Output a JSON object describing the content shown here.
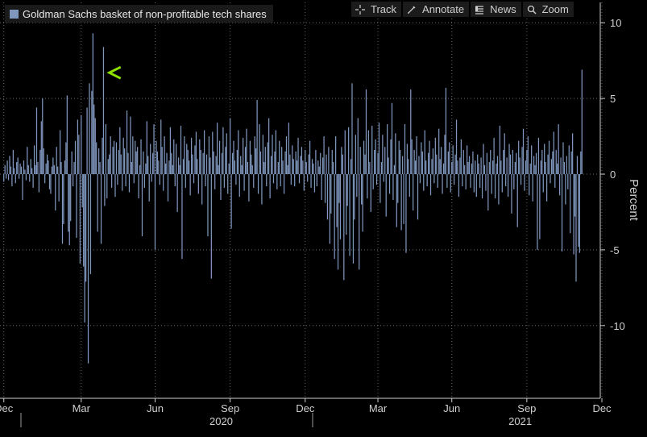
{
  "legend": {
    "label": "Goldman Sachs basket of non-profitable tech shares",
    "swatch_color": "#7f96bd"
  },
  "toolbar": [
    {
      "label": "Track",
      "icon": "crosshair-icon"
    },
    {
      "label": "Annotate",
      "icon": "pencil-icon"
    },
    {
      "label": "News",
      "icon": "news-icon"
    },
    {
      "label": "Zoom",
      "icon": "magnifier-icon"
    }
  ],
  "chart_data": {
    "type": "bar",
    "ylabel": "Percent",
    "ylim": [
      -13.5,
      11
    ],
    "yticks": [
      10,
      5,
      0,
      -5,
      -10
    ],
    "grid": true,
    "bar_color": "#7f96bd",
    "annotation": {
      "type": "arrow",
      "color": "#8ee000",
      "y": 6.7,
      "from_index": 500,
      "to_index": 90
    },
    "month_ticks": [
      {
        "label": "Dec",
        "index": 0
      },
      {
        "label": "Mar",
        "index": 66
      },
      {
        "label": "Jun",
        "index": 129
      },
      {
        "label": "Sep",
        "index": 193
      },
      {
        "label": "Dec",
        "index": 257
      },
      {
        "label": "Mar",
        "index": 319
      },
      {
        "label": "Jun",
        "index": 382
      },
      {
        "label": "Sep",
        "index": 446
      },
      {
        "label": "Dec",
        "index": 510
      }
    ],
    "year_labels": [
      {
        "label": "2020",
        "index": 140
      },
      {
        "label": "2021",
        "index": 395
      }
    ],
    "values": [
      -0.5,
      0.6,
      -0.3,
      0.9,
      -0.4,
      1.2,
      0.5,
      -0.8,
      1.6,
      0.4,
      -0.6,
      0.8,
      1.1,
      -0.3,
      0.7,
      0.5,
      -1.7,
      0.9,
      0.3,
      -0.4,
      1.8,
      0.6,
      -0.5,
      1.0,
      0.4,
      -0.9,
      1.9,
      0.6,
      4.4,
      0.8,
      -1.2,
      1.6,
      3.5,
      5.0,
      1.7,
      -0.6,
      0.7,
      1.3,
      0.9,
      -1.0,
      -1.3,
      0.5,
      1.1,
      0.6,
      -2.4,
      1.8,
      0.5,
      -1.8,
      2.9,
      0.8,
      -4.6,
      -3.3,
      0.9,
      2.1,
      5.2,
      -3.8,
      -4.7,
      -3.1,
      1.5,
      -0.8,
      0.8,
      2.2,
      -4.2,
      3.6,
      2.6,
      -5.9,
      3.9,
      -2.2,
      -6.1,
      -9.8,
      -7.1,
      4.4,
      -12.5,
      6.0,
      -6.6,
      5.5,
      9.3,
      4.6,
      3.7,
      2.1,
      -3.8,
      1.7,
      0.8,
      -4.6,
      2.4,
      8.4,
      -2.1,
      3.3,
      -1.6,
      1.0,
      1.3,
      2.5,
      -0.9,
      1.8,
      2.2,
      -1.5,
      2.1,
      -0.7,
      1.6,
      3.1,
      1.3,
      -1.1,
      2.4,
      1.7,
      -0.8,
      4.2,
      1.4,
      -1.2,
      3.8,
      0.8,
      2.5,
      -0.6,
      2.2,
      1.5,
      1.8,
      -1.6,
      0.6,
      2.3,
      -4.1,
      1.5,
      -0.9,
      0.7,
      3.5,
      1.2,
      -1.8,
      2.0,
      -0.5,
      1.4,
      3.3,
      -5.0,
      2.2,
      1.5,
      0.9,
      -0.7,
      3.6,
      1.8,
      -1.1,
      2.5,
      0.7,
      1.4,
      -1.8,
      0.9,
      3.1,
      1.4,
      0.6,
      2.3,
      -0.8,
      2.0,
      -2.5,
      1.1,
      0.6,
      3.2,
      -5.6,
      1.0,
      2.5,
      -0.9,
      2.0,
      1.6,
      0.9,
      -1.4,
      2.4,
      1.3,
      -0.6,
      1.9,
      2.8,
      1.0,
      -1.3,
      2.3,
      1.6,
      -2.0,
      1.4,
      2.9,
      -0.8,
      1.3,
      -4.1,
      2.5,
      1.1,
      -6.9,
      2.8,
      1.5,
      -1.0,
      1.2,
      3.4,
      0.6,
      2.2,
      -1.7,
      1.4,
      3.1,
      -0.9,
      1.8,
      2.7,
      -1.3,
      0.7,
      3.7,
      -3.6,
      1.4,
      2.2,
      0.9,
      -0.7,
      1.6,
      2.9,
      -1.5,
      1.2,
      0.6,
      2.4,
      -1.1,
      1.8,
      3.0,
      0.8,
      -1.8,
      2.2,
      1.3,
      0.6,
      -0.9,
      2.5,
      1.7,
      4.9,
      -1.3,
      3.3,
      1.5,
      -2.0,
      2.6,
      0.8,
      1.8,
      -0.8,
      2.1,
      3.7,
      -1.6,
      1.2,
      2.6,
      -0.6,
      1.5,
      2.9,
      -1.0,
      0.8,
      2.2,
      -0.8,
      1.8,
      0.9,
      -1.3,
      1.5,
      2.5,
      0.6,
      3.4,
      1.3,
      -0.7,
      1.9,
      1.0,
      -0.8,
      1.5,
      0.9,
      2.4,
      -0.6,
      1.2,
      1.8,
      0.9,
      -1.1,
      1.6,
      0.8,
      -0.5,
      1.3,
      2.2,
      -0.9,
      1.0,
      0.7,
      -1.2,
      1.6,
      -0.8,
      0.9,
      0.5,
      1.4,
      -1.7,
      1.1,
      2.5,
      -1.9,
      1.3,
      -3.0,
      1.8,
      -4.6,
      -2.6,
      1.6,
      0.8,
      -5.6,
      2.5,
      -3.5,
      -6.3,
      -1.9,
      -4.3,
      1.8,
      1.3,
      -7.0,
      2.9,
      -4.0,
      -2.1,
      3.1,
      -5.4,
      1.0,
      6.0,
      -5.9,
      -3.0,
      2.6,
      -1.5,
      3.7,
      -6.3,
      1.8,
      -2.0,
      -3.8,
      2.2,
      1.3,
      5.6,
      -1.6,
      2.9,
      0.8,
      -2.5,
      3.2,
      -1.0,
      1.6,
      2.3,
      -0.7,
      1.4,
      3.4,
      -1.9,
      0.8,
      2.6,
      -0.5,
      1.8,
      -2.8,
      3.3,
      1.1,
      -1.3,
      2.3,
      4.7,
      -1.7,
      0.6,
      2.7,
      -3.5,
      -1.9,
      2.2,
      1.6,
      -3.7,
      1.2,
      -3.3,
      3.3,
      -5.2,
      2.0,
      1.0,
      -1.5,
      5.6,
      2.3,
      -2.4,
      1.6,
      0.9,
      2.5,
      -3.0,
      1.2,
      -0.6,
      2.1,
      1.5,
      -1.1,
      2.9,
      0.9,
      -0.8,
      1.4,
      2.2,
      -1.4,
      1.0,
      1.7,
      -0.6,
      2.4,
      1.3,
      -0.9,
      3.0,
      1.0,
      1.8,
      -1.3,
      0.7,
      2.6,
      5.7,
      -0.9,
      1.5,
      2.1,
      -1.2,
      0.8,
      1.9,
      -0.7,
      1.3,
      3.6,
      0.9,
      -1.5,
      1.1,
      2.3,
      -0.8,
      1.6,
      0.6,
      -1.0,
      1.9,
      0.8,
      1.2,
      -0.9,
      0.7,
      1.5,
      -1.2,
      0.9,
      -1.5,
      1.3,
      0.7,
      -0.9,
      1.1,
      -1.6,
      2.0,
      0.6,
      -1.1,
      1.4,
      -2.4,
      0.8,
      1.6,
      -1.3,
      0.9,
      2.4,
      -1.6,
      0.7,
      1.2,
      -2.0,
      3.2,
      0.9,
      -1.2,
      1.6,
      2.7,
      -0.8,
      1.1,
      -1.5,
      2.0,
      1.3,
      -2.6,
      1.6,
      -1.0,
      0.8,
      1.4,
      -3.5,
      2.2,
      1.1,
      -0.7,
      1.8,
      3.0,
      -1.1,
      0.9,
      1.6,
      2.5,
      -1.4,
      0.7,
      1.9,
      -1.8,
      1.2,
      0.6,
      1.4,
      -5.0,
      2.4,
      -4.3,
      0.9,
      1.6,
      -1.2,
      2.0,
      0.8,
      -1.8,
      1.3,
      2.2,
      -0.6,
      1.0,
      1.5,
      2.8,
      -0.9,
      1.6,
      0.7,
      3.3,
      -1.4,
      1.1,
      -5.1,
      2.1,
      0.8,
      -2.0,
      1.2,
      -1.0,
      1.9,
      -3.9,
      1.5,
      2.7,
      -5.3,
      -2.8,
      -7.1,
      1.2,
      -4.8,
      -5.2,
      1.5,
      6.9
    ]
  }
}
